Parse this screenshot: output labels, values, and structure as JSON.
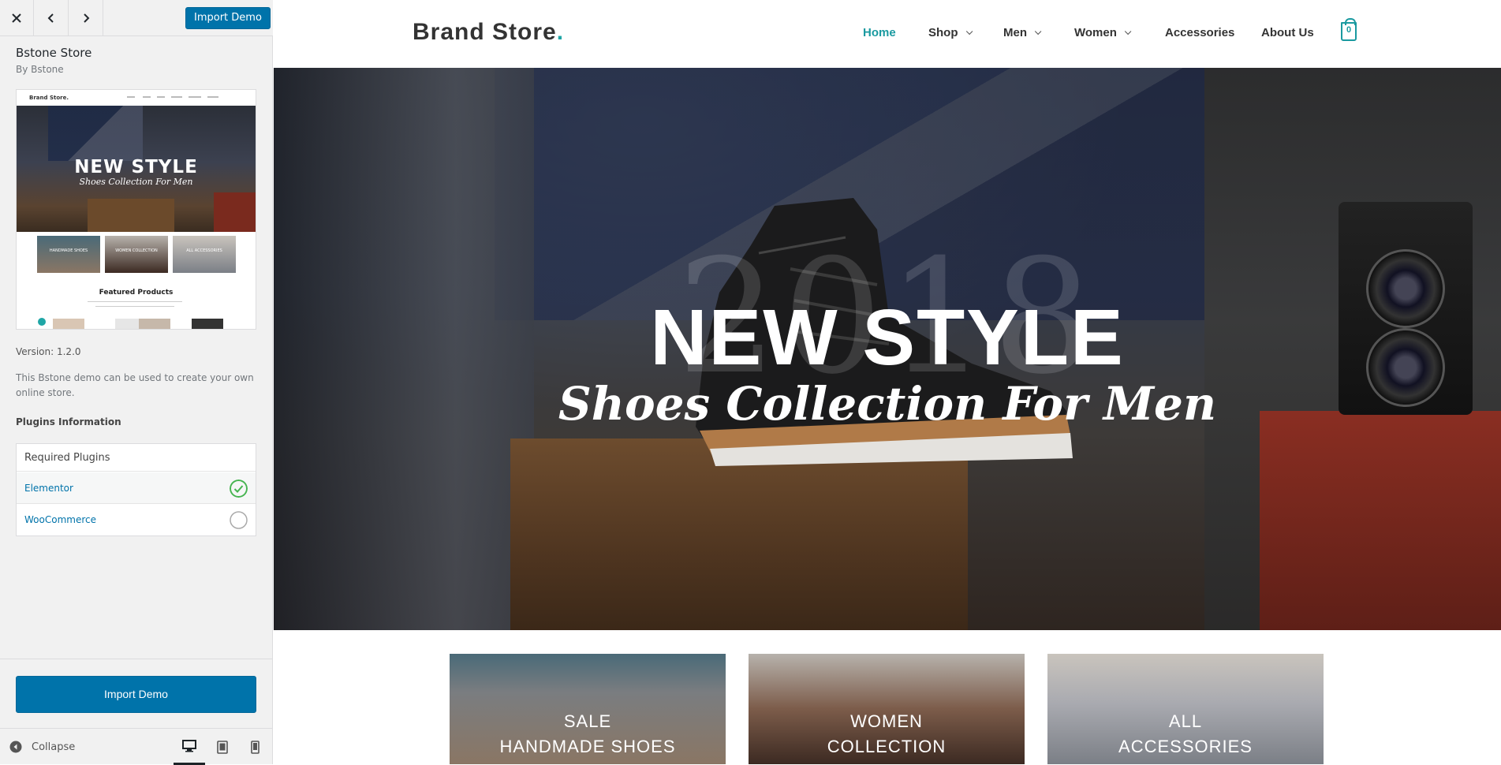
{
  "sidebar": {
    "import_top_label": "Import Demo",
    "theme_title": "Bstone Store",
    "theme_author": "By Bstone",
    "thumbnail": {
      "logo": "Brand Store.",
      "hero_title": "NEW STYLE",
      "hero_subtitle": "Shoes Collection For Men",
      "cat1": "HANDMADE SHOES",
      "cat2": "WOMEN COLLECTION",
      "cat3": "ALL ACCESSORIES",
      "featured": "Featured Products"
    },
    "version": "Version: 1.2.0",
    "description": "This Bstone demo can be used to create your own online store.",
    "plugins_heading": "Plugins Information",
    "plugins_table_header": "Required Plugins",
    "plugins": [
      {
        "name": "Elementor",
        "installed": true
      },
      {
        "name": "WooCommerce",
        "installed": false
      }
    ],
    "import_bottom_label": "Import Demo",
    "collapse_label": "Collapse",
    "icons": {
      "close": "close-icon",
      "prev": "chevron-left-icon",
      "next": "chevron-right-icon",
      "collapse": "collapse-arrow-icon",
      "desktop": "desktop-icon",
      "tablet": "tablet-icon",
      "mobile": "mobile-icon"
    }
  },
  "site": {
    "logo_text": "Brand Store",
    "logo_dot": ".",
    "nav": [
      {
        "label": "Home",
        "active": true
      },
      {
        "label": "Shop",
        "dropdown": true
      },
      {
        "label": "Men",
        "dropdown": true
      },
      {
        "label": "Women",
        "dropdown": true
      },
      {
        "label": "Accessories"
      },
      {
        "label": "About Us"
      }
    ],
    "cart_count": "0",
    "hero": {
      "year": "2018",
      "title": "NEW STYLE",
      "subtitle": "Shoes Collection For Men"
    },
    "categories": [
      {
        "line1": "SALE",
        "line2": "HANDMADE SHOES"
      },
      {
        "line1": "WOMEN",
        "line2": "COLLECTION"
      },
      {
        "line1": "ALL",
        "line2": "ACCESSORIES"
      }
    ],
    "colors": {
      "accent": "#1a9aa0",
      "button": "#0073aa",
      "check": "#46b450"
    }
  }
}
